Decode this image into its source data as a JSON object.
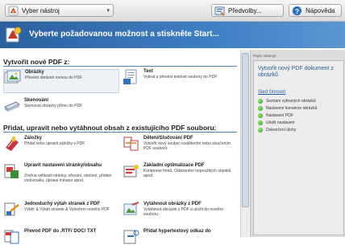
{
  "toolbar": {
    "tool_label": "Vyber nástroj",
    "pref_label": "Předvolby...",
    "help_label": "Nápověda"
  },
  "header": {
    "title": "Vyberte požadovanou možnost a stiskněte Start..."
  },
  "sections": [
    {
      "title": "Vytvořit nové PDF z:",
      "items": [
        {
          "title": "Obrázky",
          "desc": "Převést obrázek rovnou do PDF"
        },
        {
          "title": "Text",
          "desc": "Vybrat a převést textové soubory do PDF"
        },
        {
          "title": "Skenování",
          "desc": "Skenovat obrázky přímo do PDF"
        }
      ]
    },
    {
      "title": "Přidat, upravit nebo vytáhnout obsah z existujícího PDF souboru:",
      "items": [
        {
          "title": "Záložky",
          "desc": "Přidat nebo upravit záložky v PDF"
        },
        {
          "title": "Dělení/Slučování PDF",
          "desc": "Vytvořit nový soubor rozdělením nebo sloučením PDF souborů"
        },
        {
          "title": "Upravit nastavení stránky/obsahu",
          "desc": "Změna velikosti stránky, ořezání, otočení, přidání vodoznaku, úprava minatur apod."
        },
        {
          "title": "Základní optimalizace PDF",
          "desc": "Komprese fontů, Odstranění nepoužitých objektů apod."
        },
        {
          "title": "Jednoduchý výtah stránek z PDF",
          "desc": "Výběr & Výtah stránek & Vytvoření nového PDF"
        },
        {
          "title": "Vytáhnout obrázky z PDF",
          "desc": "Vytáhnout obrázek z PDF a uložit do nového souboru"
        },
        {
          "title": "Převod PDF do .RTF/ DOC/ TXT",
          "desc": ""
        },
        {
          "title": "Přidat hypertextový odkaz do",
          "desc": ""
        }
      ]
    }
  ],
  "right_pane": {
    "panel_title": "Popis nástroje",
    "main_task": "Vytvořit nový PDF dokument z obrázků",
    "sequence_title": "Sled činností",
    "steps": [
      "Seznam vybraných obrázků",
      "Nastavení konverze obrázků",
      "Nastavení PDF",
      "Uložit nastavení",
      "Dokončení úlohy"
    ]
  }
}
